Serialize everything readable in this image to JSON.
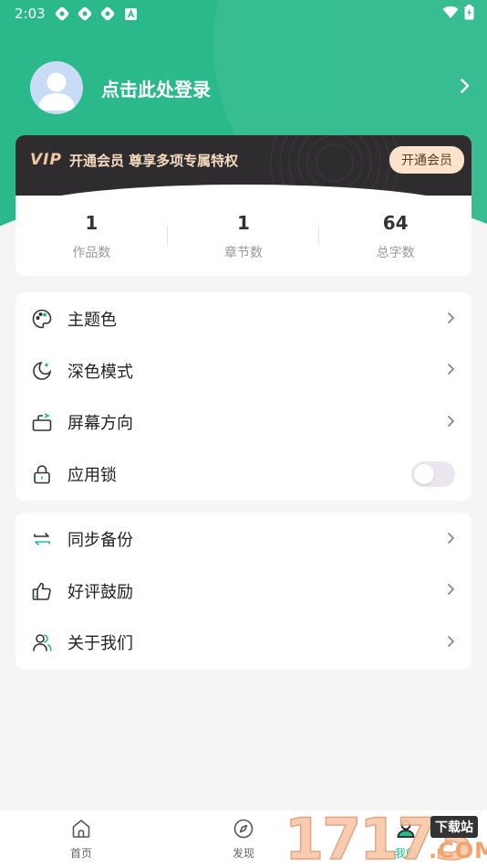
{
  "status_bar": {
    "time": "2:03"
  },
  "profile": {
    "login_text": "点击此处登录"
  },
  "vip": {
    "logo": "VIP",
    "text": "开通会员 尊享多项专属特权",
    "button": "开通会员"
  },
  "stats": [
    {
      "value": "1",
      "label": "作品数"
    },
    {
      "value": "1",
      "label": "章节数"
    },
    {
      "value": "64",
      "label": "总字数"
    }
  ],
  "settings_menu": [
    {
      "label": "主题色",
      "icon": "palette-icon"
    },
    {
      "label": "深色模式",
      "icon": "moon-icon"
    },
    {
      "label": "屏幕方向",
      "icon": "screen-rotation-icon"
    },
    {
      "label": "应用锁",
      "icon": "lock-icon",
      "toggle": false
    }
  ],
  "extra_menu": [
    {
      "label": "同步备份",
      "icon": "sync-icon"
    },
    {
      "label": "好评鼓励",
      "icon": "thumbs-up-icon"
    },
    {
      "label": "关于我们",
      "icon": "users-icon"
    }
  ],
  "bottom_nav": [
    {
      "label": "首页",
      "icon": "home-icon"
    },
    {
      "label": "发现",
      "icon": "compass-icon"
    },
    {
      "label": "我的",
      "icon": "profile-icon",
      "active": true
    }
  ],
  "watermark": {
    "digits": "17173",
    "tag": "下载站",
    "domain": ".COM"
  },
  "colors": {
    "primary": "#2bb98b",
    "vip_dark": "#2f2c30",
    "vip_gold": "#f5dcc0"
  }
}
